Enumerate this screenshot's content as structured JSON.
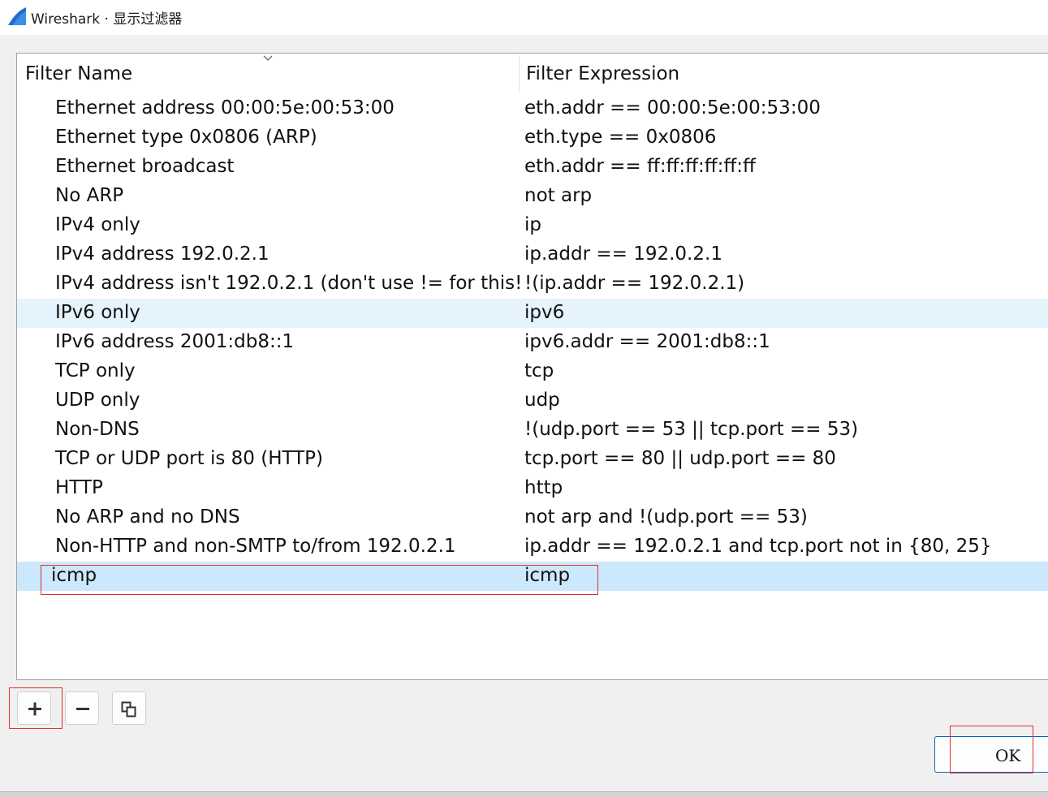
{
  "window": {
    "app_icon": "wireshark-fin-icon",
    "title": "Wireshark · 显示过滤器"
  },
  "table": {
    "columns": {
      "name": "Filter Name",
      "expression": "Filter Expression"
    },
    "sort_indicator": "chevron-down-icon",
    "rows": [
      {
        "name": "Ethernet address 00:00:5e:00:53:00",
        "expression": "eth.addr == 00:00:5e:00:53:00"
      },
      {
        "name": "Ethernet type 0x0806 (ARP)",
        "expression": "eth.type == 0x0806"
      },
      {
        "name": "Ethernet broadcast",
        "expression": "eth.addr == ff:ff:ff:ff:ff:ff"
      },
      {
        "name": "No ARP",
        "expression": "not arp"
      },
      {
        "name": "IPv4 only",
        "expression": "ip"
      },
      {
        "name": "IPv4 address 192.0.2.1",
        "expression": "ip.addr == 192.0.2.1"
      },
      {
        "name": "IPv4 address isn't 192.0.2.1 (don't use != for this!)",
        "expression": "!(ip.addr == 192.0.2.1)"
      },
      {
        "name": "IPv6 only",
        "expression": "ipv6",
        "state": "hover"
      },
      {
        "name": "IPv6 address 2001:db8::1",
        "expression": "ipv6.addr == 2001:db8::1"
      },
      {
        "name": "TCP only",
        "expression": "tcp"
      },
      {
        "name": "UDP only",
        "expression": "udp"
      },
      {
        "name": "Non-DNS",
        "expression": "!(udp.port == 53 || tcp.port == 53)"
      },
      {
        "name": "TCP or UDP port is 80 (HTTP)",
        "expression": "tcp.port == 80 || udp.port == 80"
      },
      {
        "name": "HTTP",
        "expression": "http"
      },
      {
        "name": "No ARP and no DNS",
        "expression": "not arp and !(udp.port == 53)"
      },
      {
        "name": "Non-HTTP and non-SMTP to/from 192.0.2.1",
        "expression": "ip.addr == 192.0.2.1 and tcp.port not in {80, 25}"
      },
      {
        "name": "icmp",
        "expression": "icmp",
        "state": "selected"
      }
    ]
  },
  "toolbar": {
    "add_icon": "plus-icon",
    "remove_icon": "minus-icon",
    "copy_icon": "copy-icon"
  },
  "dialog_buttons": {
    "ok_label": "OK"
  },
  "colors": {
    "hover_row": "#e5f3fd",
    "selected_row": "#cce8fd",
    "annotation_red": "#e0302e",
    "default_button_border": "#0067c0",
    "wireshark_blue": "#1c6fd1"
  }
}
